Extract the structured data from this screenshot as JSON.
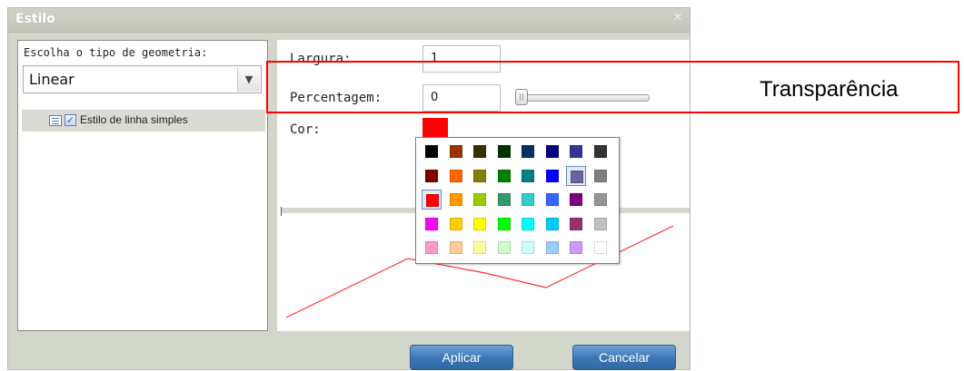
{
  "dialog": {
    "title": "Estilo",
    "close_icon": "close-icon"
  },
  "left": {
    "geometry_label": "Escolha o tipo de geometria:",
    "geometry_value": "Linear",
    "dropdown_icon": "chevron-down-icon",
    "tree_item": {
      "label": "Estilo de linha simples",
      "checked": true
    }
  },
  "right": {
    "width_label": "Largura:",
    "width_value": "1",
    "percent_label": "Percentagem:",
    "percent_value": "0",
    "slider_value": 0,
    "color_label": "Cor:",
    "color_value": "#ff0000"
  },
  "palette": {
    "rows": [
      [
        "#000000",
        "#993300",
        "#333300",
        "#003300",
        "#003366",
        "#000080",
        "#333399",
        "#333333"
      ],
      [
        "#800000",
        "#ff6600",
        "#808000",
        "#008000",
        "#008080",
        "#0000ff",
        "#666699",
        "#808080"
      ],
      [
        "#ff0000",
        "#ff9900",
        "#99cc00",
        "#339966",
        "#33cccc",
        "#3366ff",
        "#800080",
        "#969696"
      ],
      [
        "#ff00ff",
        "#ffcc00",
        "#ffff00",
        "#00ff00",
        "#00ffff",
        "#00ccff",
        "#993366",
        "#c0c0c0"
      ],
      [
        "#ff99cc",
        "#ffcc99",
        "#ffff99",
        "#ccffcc",
        "#ccffff",
        "#99ccff",
        "#cc99ff",
        "#ffffff"
      ]
    ],
    "selected": [
      "#666699",
      "#ff0000"
    ]
  },
  "buttons": {
    "apply": "Aplicar",
    "cancel": "Cancelar"
  },
  "annotation": {
    "label": "Transparência",
    "color": "#ff0000"
  }
}
